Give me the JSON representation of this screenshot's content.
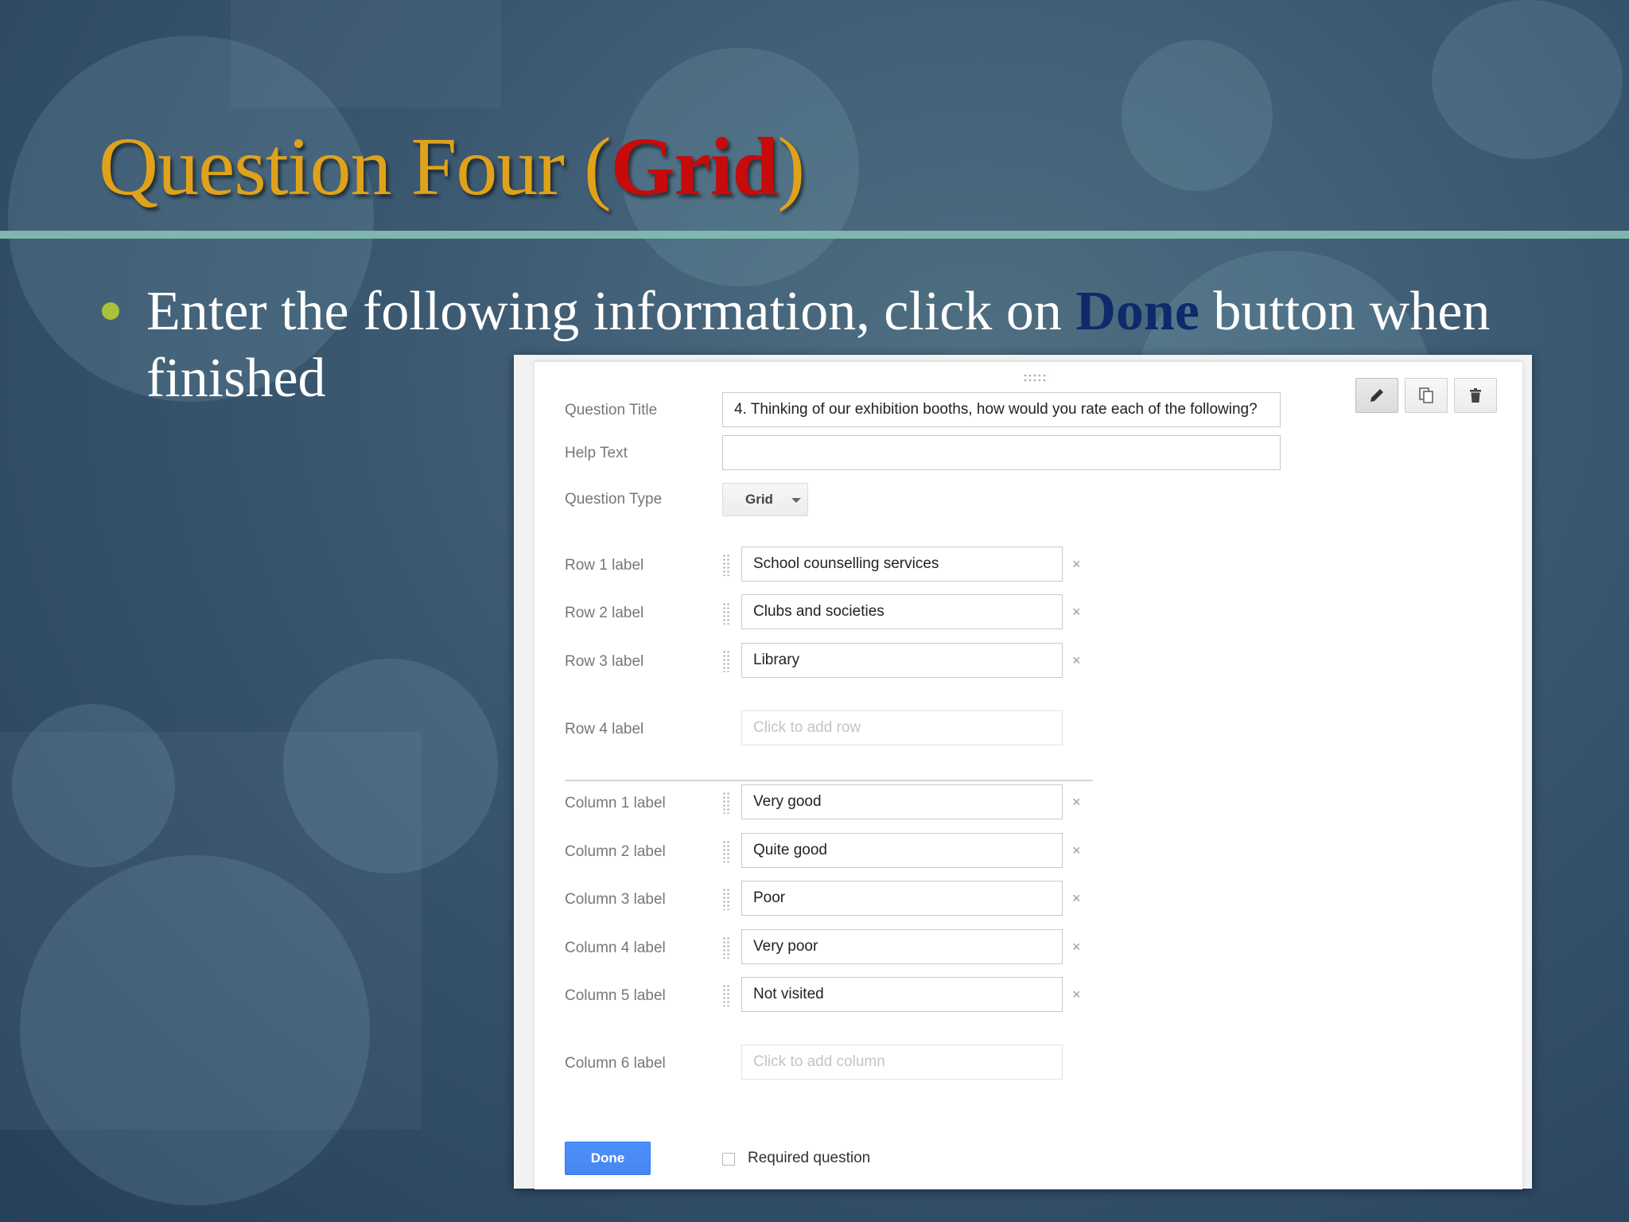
{
  "slide": {
    "title_main": "Question Four (",
    "title_accent": "Grid",
    "title_close": ")",
    "bullet_before": "Enter the following information, click on ",
    "bullet_emphasis": "Done",
    "bullet_after": " button when finished"
  },
  "form": {
    "question_title_label": "Question Title",
    "question_title_value": "4. Thinking of our exhibition booths, how would you rate each of the following?",
    "help_text_label": "Help Text",
    "help_text_value": "",
    "question_type_label": "Question Type",
    "question_type_value": "Grid",
    "rows": [
      {
        "label": "Row 1 label",
        "value": "School counselling services"
      },
      {
        "label": "Row 2 label",
        "value": "Clubs and societies"
      },
      {
        "label": "Row 3 label",
        "value": "Library"
      }
    ],
    "add_row": {
      "label": "Row 4 label",
      "placeholder": "Click to add row"
    },
    "columns": [
      {
        "label": "Column 1 label",
        "value": "Very good"
      },
      {
        "label": "Column 2 label",
        "value": "Quite good"
      },
      {
        "label": "Column 3 label",
        "value": "Poor"
      },
      {
        "label": "Column 4 label",
        "value": "Very poor"
      },
      {
        "label": "Column 5 label",
        "value": "Not visited"
      }
    ],
    "add_column": {
      "label": "Column 6 label",
      "placeholder": "Click to add column"
    },
    "remove_symbol": "×",
    "done_label": "Done",
    "required_label": "Required question",
    "required_checked": false
  },
  "toolbar": {
    "edit_icon": "pencil-icon",
    "duplicate_icon": "duplicate-icon",
    "delete_icon": "trash-icon"
  },
  "colors": {
    "title": "#e0a21a",
    "title_accent": "#c70a0a",
    "bullet_emphasis": "#0f2a6a",
    "rule": "#7fb6ad",
    "done_button": "#4d90fe"
  }
}
